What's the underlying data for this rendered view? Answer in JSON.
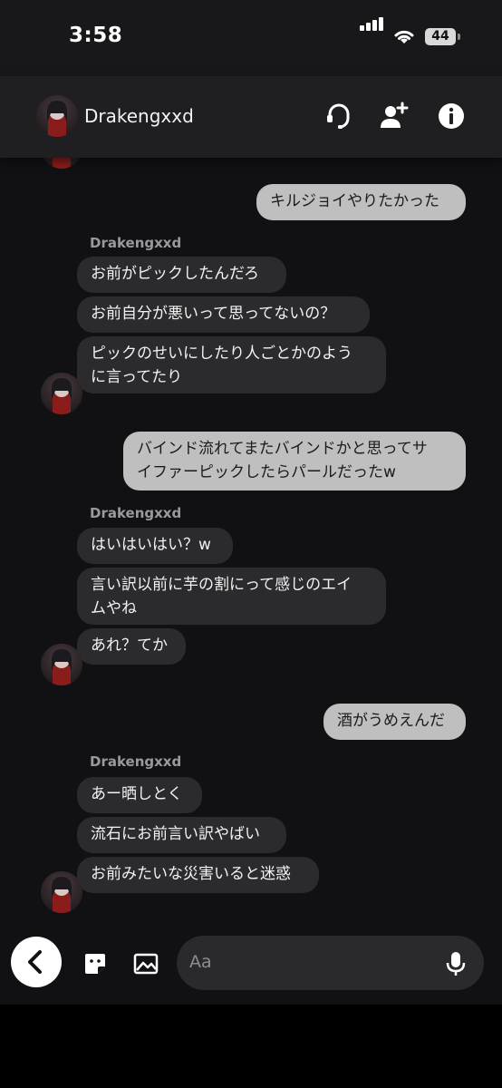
{
  "status_bar": {
    "time": "3:58",
    "battery": "44"
  },
  "header": {
    "contact_name": "Drakengxxd"
  },
  "messages": {
    "m1": "キルジョイやりたかった",
    "g1": {
      "sender": "Drakengxxd",
      "b1": "お前がピックしたんだろ",
      "b2": "お前自分が悪いって思ってないの？",
      "b3_line1": "ピックのせいにしたり人ごとかのよう",
      "b3_line2": "に言ってたり"
    },
    "m2_line1": "バインド流れてまたバインドかと思ってサ",
    "m2_line2": "イファーピックしたらパールだったw",
    "g2": {
      "sender": "Drakengxxd",
      "b1": "はいはいはい？w",
      "b2_line1": "言い訳以前に芋の割にって感じのエイ",
      "b2_line2": "ムやね",
      "b3": "あれ？てか"
    },
    "m3": "酒がうめえんだ",
    "g3": {
      "sender": "Drakengxxd",
      "b1": "あー晒しとく",
      "b2": "流石にお前言い訳やばい",
      "b3": "お前みたいな災害いると迷惑"
    }
  },
  "composer": {
    "placeholder": "Aa"
  },
  "colors": {
    "incoming_bubble": "#2b2b2e",
    "outgoing_bubble": "#bfbfbf",
    "background": "#111113"
  }
}
